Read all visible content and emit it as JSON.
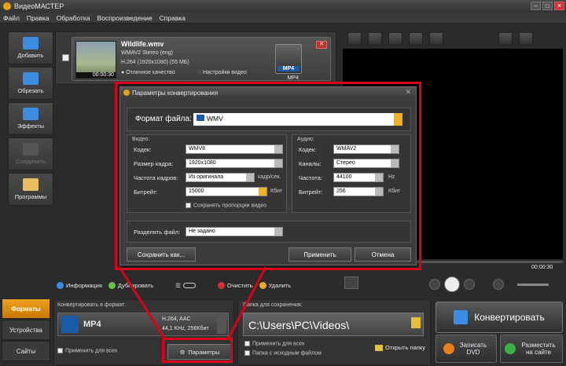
{
  "app": {
    "title": "ВидеоМАСТЕР"
  },
  "menu": [
    "Файл",
    "Правка",
    "Обработка",
    "Воспроизведение",
    "Справка"
  ],
  "sidebar": [
    {
      "label": "Добавить",
      "enabled": true,
      "color": "#3a8de0"
    },
    {
      "label": "Обрезать",
      "enabled": true,
      "color": "#3a8de0"
    },
    {
      "label": "Эффекты",
      "enabled": true,
      "color": "#3a8de0"
    },
    {
      "label": "Соединить",
      "enabled": false,
      "color": "#555555"
    },
    {
      "label": "Программы",
      "enabled": true,
      "color": "#e8c060"
    }
  ],
  "file": {
    "name": "Wildlife.wmv",
    "audio": "WMAV2 Stereo (eng)",
    "video": "H.264 (1920x1080) (55 МБ)",
    "quality": "Отличное качество",
    "settings": "Настройки видео",
    "duration": "00:00:30",
    "format": "MP4"
  },
  "preview": {
    "timecode": "00:00:30"
  },
  "toolbar": {
    "info": "Информация",
    "duplicate": "Дублировать",
    "clear": "Очистить",
    "delete": "Удалить"
  },
  "bottom_tabs": [
    "Форматы",
    "Устройства",
    "Сайты"
  ],
  "convert_panel": {
    "label": "Конвертировать в формат:",
    "format": "MP4",
    "codec": "H.264, AAC",
    "audio": "44,1 KHz, 256Кбит",
    "apply_all": "Применить для всех",
    "params": "Параметры"
  },
  "save_panel": {
    "label": "Папка для сохранения:",
    "path": "C:\\Users\\PC\\Videos\\",
    "apply_all": "Применить для всех",
    "source_folder": "Папка с исходным файлом",
    "open_folder": "Открыть папку"
  },
  "actions": {
    "convert": "Конвертировать",
    "dvd": "Записать DVD",
    "web": "Разместить на сайте"
  },
  "dialog": {
    "title": "Параметры конвертирования",
    "format_label": "Формат файла:",
    "format_value": "WMV",
    "video": {
      "group": "Видео:",
      "codec_label": "Кодек:",
      "codec": "WMV8",
      "size_label": "Размер кадра:",
      "size": "1920x1080",
      "fps_label": "Частота кадров:",
      "fps": "Из оригинала",
      "fps_unit": "кадр/сек.",
      "bitrate_label": "Битрейт:",
      "bitrate": "15000",
      "bitrate_unit": "Кбит",
      "keep_ratio": "Сохранять пропорции видео"
    },
    "audio": {
      "group": "Аудио:",
      "codec_label": "Кодек:",
      "codec": "WMAV2",
      "channels_label": "Каналы:",
      "channels": "Стерео",
      "rate_label": "Частота:",
      "rate": "44100",
      "rate_unit": "Hz",
      "bitrate_label": "Битрейт:",
      "bitrate": "256",
      "bitrate_unit": "Кбит"
    },
    "split_label": "Разделять файл:",
    "split_value": "Не задано",
    "save_as": "Сохранить как...",
    "apply": "Применить",
    "cancel": "Отмена"
  }
}
